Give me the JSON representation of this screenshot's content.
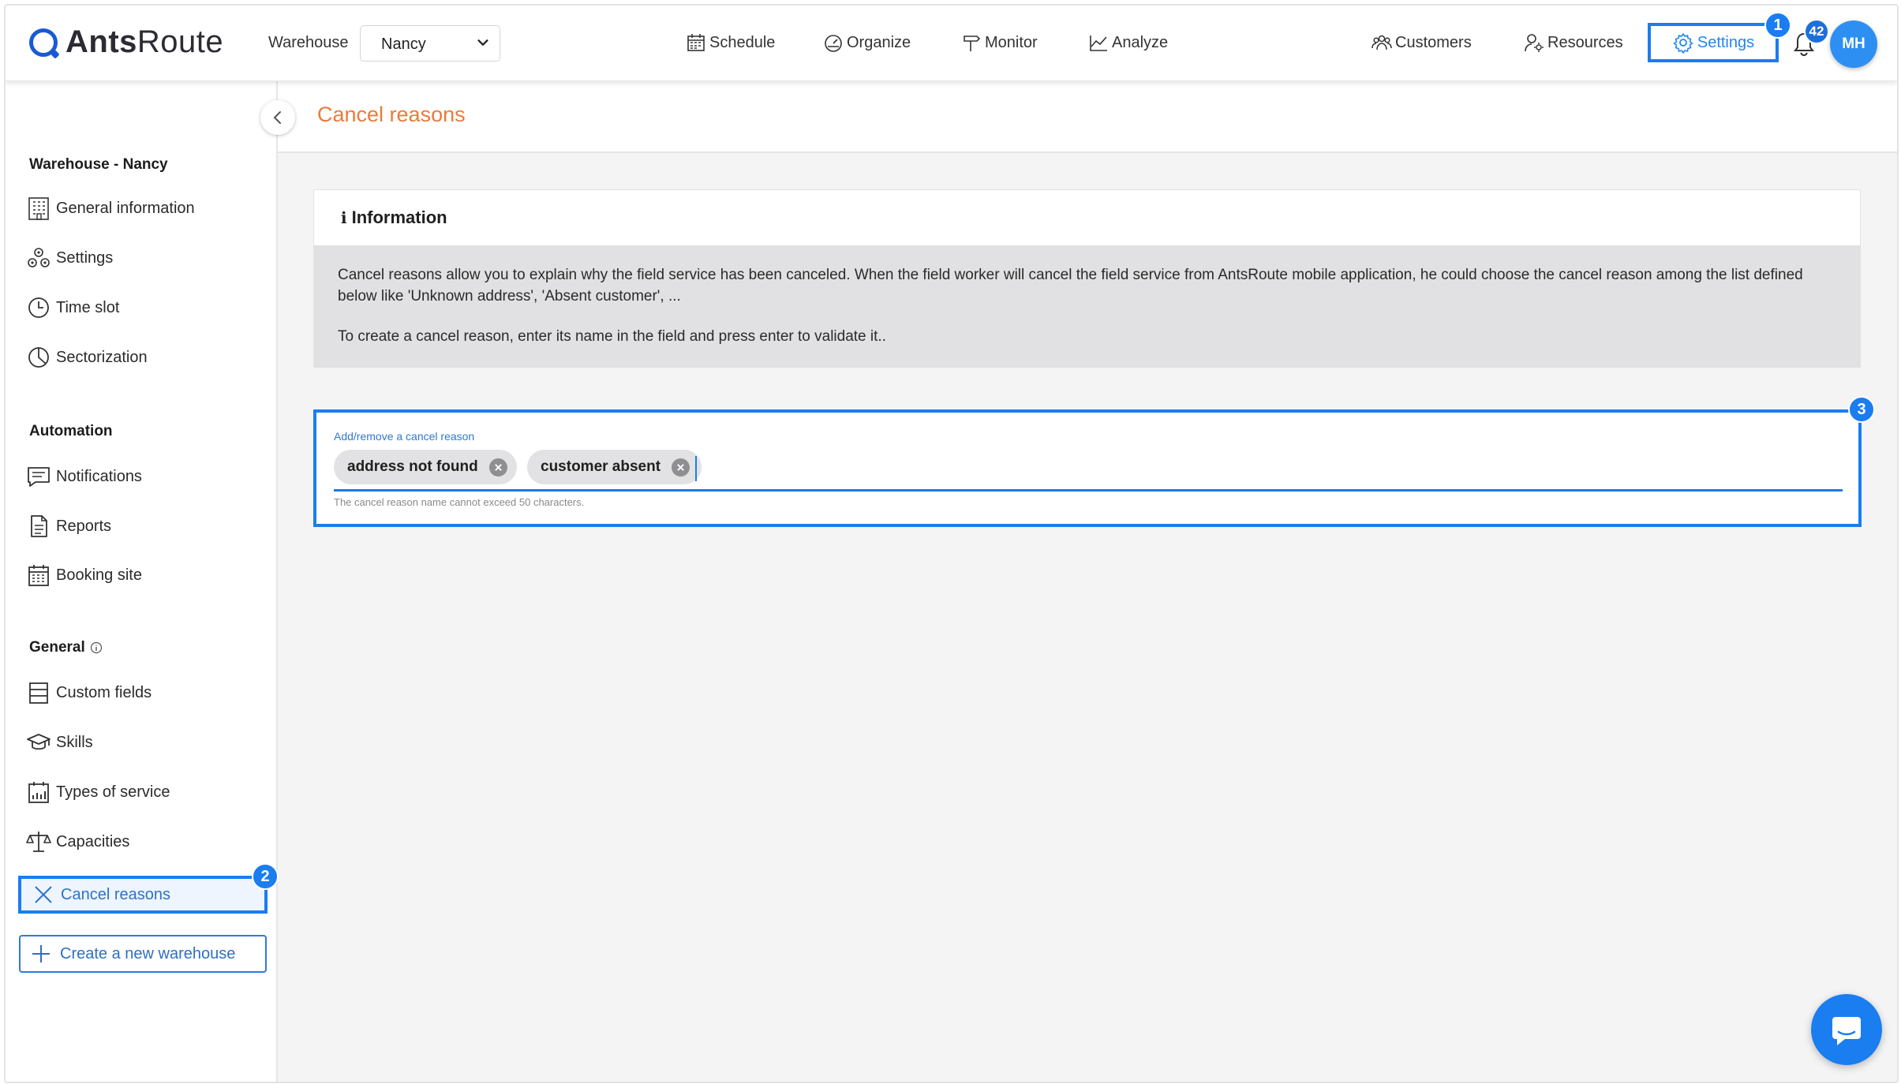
{
  "app": {
    "logo_bold": "Ants",
    "logo_light": "Route"
  },
  "header": {
    "warehouse_label": "Warehouse",
    "warehouse_value": "Nancy",
    "nav": {
      "schedule": "Schedule",
      "organize": "Organize",
      "monitor": "Monitor",
      "analyze": "Analyze",
      "customers": "Customers",
      "resources": "Resources",
      "settings": "Settings"
    },
    "notification_count": "42",
    "avatar_initials": "MH"
  },
  "steps": {
    "one": "1",
    "two": "2",
    "three": "3"
  },
  "sidebar": {
    "warehouse_heading": "Warehouse - Nancy",
    "items_warehouse": {
      "general_information": "General information",
      "settings": "Settings",
      "time_slot": "Time slot",
      "sectorization": "Sectorization"
    },
    "automation_heading": "Automation",
    "items_automation": {
      "notifications": "Notifications",
      "reports": "Reports",
      "booking_site": "Booking site"
    },
    "general_heading": "General",
    "items_general": {
      "custom_fields": "Custom fields",
      "skills": "Skills",
      "types_of_service": "Types of service",
      "capacities": "Capacities",
      "cancel_reasons": "Cancel reasons"
    },
    "create_warehouse": "Create a new warehouse"
  },
  "page": {
    "title": "Cancel reasons",
    "info_title": "Information",
    "info_paragraph_1": "Cancel reasons allow you to explain why the field service has been canceled. When the field worker will cancel the field service from AntsRoute mobile application, he could choose the cancel reason among the list defined below like 'Unknown address', 'Absent customer', ...",
    "info_paragraph_2": "To create a cancel reason, enter its name in the field and press enter to validate it..",
    "reasons_label": "Add/remove a cancel reason",
    "reasons": [
      "address not found",
      "customer absent"
    ],
    "reasons_input_value": "",
    "reasons_hint": "The cancel reason name cannot exceed 50 characters."
  },
  "colors": {
    "accent": "#1a7df0",
    "title_orange": "#ea7b3a",
    "info_bg": "#e1e1e3"
  }
}
